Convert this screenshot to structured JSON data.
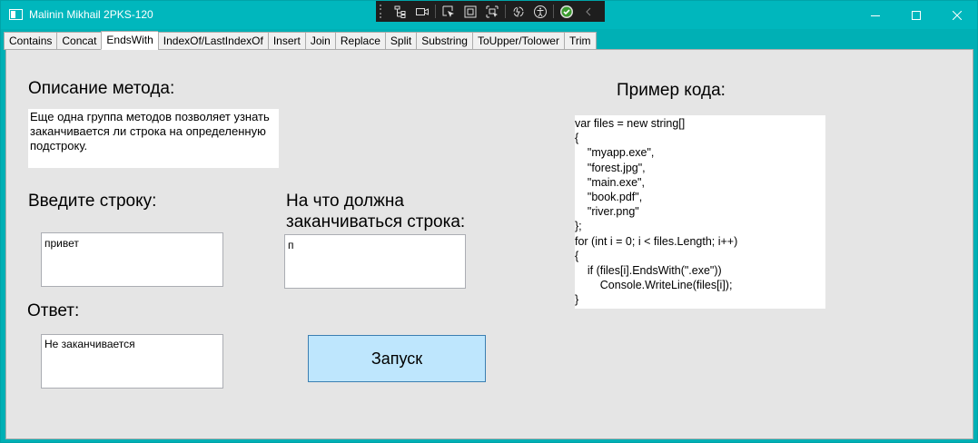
{
  "window": {
    "title": "Malinin Mikhail 2PKS-120"
  },
  "tabs": [
    {
      "label": "Contains",
      "active": false
    },
    {
      "label": "Concat",
      "active": false
    },
    {
      "label": "EndsWith",
      "active": true
    },
    {
      "label": "IndexOf/LastIndexOf",
      "active": false
    },
    {
      "label": "Insert",
      "active": false
    },
    {
      "label": "Join",
      "active": false
    },
    {
      "label": "Replace",
      "active": false
    },
    {
      "label": "Split",
      "active": false
    },
    {
      "label": "Substring",
      "active": false
    },
    {
      "label": "ToUpper/Tolower",
      "active": false
    },
    {
      "label": "Trim",
      "active": false
    }
  ],
  "main": {
    "description_label": "Описание метода:",
    "description_text": "Еще одна группа методов позволяет узнать заканчивается ли строка на определенную подстроку.",
    "input_label": "Введите строку:",
    "input_value": "привет",
    "suffix_label": "На что должна заканчиваться строка:",
    "suffix_value": "п",
    "answer_label": "Ответ:",
    "answer_value": "Не заканчивается",
    "run_button": "Запуск",
    "code_label": "Пример кода:",
    "code_text": "var files = new string[]\n{\n    \"myapp.exe\",\n    \"forest.jpg\",\n    \"main.exe\",\n    \"book.pdf\",\n    \"river.png\"\n};\nfor (int i = 0; i < files.Length; i++)\n{\n    if (files[i].EndsWith(\".exe\"))\n        Console.WriteLine(files[i]);\n}"
  },
  "colors": {
    "titlebar": "#00b7bd",
    "content_bg": "#e5e5e5",
    "button_bg": "#bee6fd",
    "button_border": "#3c7fb1"
  }
}
